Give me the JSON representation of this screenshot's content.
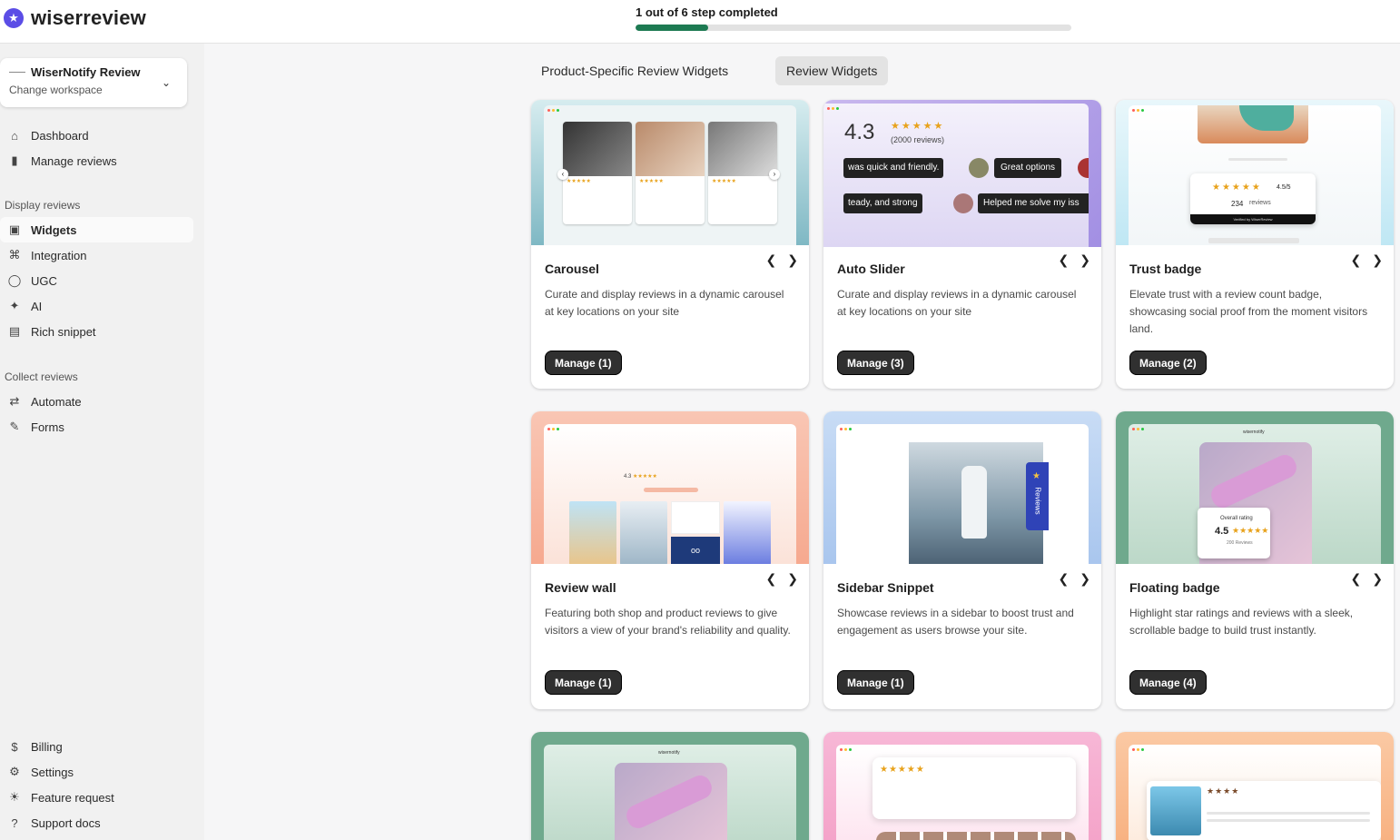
{
  "brand": {
    "logo_text": "wiserreview"
  },
  "progress": {
    "label": "1 out of 6 step completed",
    "completed": 1,
    "total": 6
  },
  "workspace": {
    "name": "WiserNotify Review",
    "action": "Change workspace"
  },
  "nav": {
    "main": [
      {
        "label": "Dashboard",
        "icon": "home-icon"
      },
      {
        "label": "Manage reviews",
        "icon": "document-icon"
      }
    ],
    "display_section": "Display reviews",
    "display": [
      {
        "label": "Widgets",
        "icon": "widget-icon",
        "active": true
      },
      {
        "label": "Integration",
        "icon": "integration-icon"
      },
      {
        "label": "UGC",
        "icon": "globe-icon"
      },
      {
        "label": "AI",
        "icon": "sparkle-icon"
      },
      {
        "label": "Rich snippet",
        "icon": "snippet-icon"
      }
    ],
    "collect_section": "Collect reviews",
    "collect": [
      {
        "label": "Automate",
        "icon": "repeat-icon"
      },
      {
        "label": "Forms",
        "icon": "edit-icon"
      }
    ],
    "bottom": [
      {
        "label": "Billing",
        "icon": "billing-icon"
      },
      {
        "label": "Settings",
        "icon": "gear-icon"
      },
      {
        "label": "Feature request",
        "icon": "sun-icon"
      },
      {
        "label": "Support docs",
        "icon": "help-icon"
      }
    ]
  },
  "tabs": [
    {
      "label": "Product-Specific Review Widgets",
      "active": false
    },
    {
      "label": "Review Widgets",
      "active": true
    }
  ],
  "widgets": [
    {
      "title": "Carousel",
      "description": "Curate and display reviews in a dynamic carousel at key locations on your site",
      "button": "Manage (1)"
    },
    {
      "title": "Auto Slider",
      "description": "Curate and display reviews in a dynamic carousel at key locations on your site",
      "button": "Manage (3)"
    },
    {
      "title": "Trust badge",
      "description": "Elevate trust with a review count badge, showcasing social proof from the moment visitors land.",
      "button": "Manage (2)"
    },
    {
      "title": "Review wall",
      "description": "Featuring both shop and product reviews to give visitors a view of your brand's reliability and quality.",
      "button": "Manage (1)"
    },
    {
      "title": "Sidebar Snippet",
      "description": "Showcase reviews in a sidebar to boost trust and engagement as users browse your site.",
      "button": "Manage (1)"
    },
    {
      "title": "Floating badge",
      "description": "Highlight star ratings and reviews with a sleek, scrollable badge to build trust instantly.",
      "button": "Manage (4)"
    }
  ],
  "previews": {
    "auto_slider": {
      "rating": "4.3",
      "count": "(2000 reviews)",
      "chips_row1": [
        "was quick and friendly.",
        "Great options"
      ],
      "chips_row2": [
        "teady, and strong",
        "Helped me solve my iss"
      ]
    },
    "trust_badge": {
      "rating": "4.5/5",
      "count": "234",
      "count_label": "reviews",
      "footer": "Verified by WiserReview"
    },
    "review_wall": {
      "rating": "4.3"
    },
    "sidebar": {
      "tab_label": "Reviews"
    },
    "floating": {
      "brand": "wisernotify",
      "label": "Overall rating",
      "rating": "4.5",
      "count": "200 Reviews"
    },
    "bottom_brand": "wisernotify"
  },
  "colors": {
    "accent": "#5b4de6",
    "progress": "#1d7a52",
    "button": "#303030",
    "star": "#e8a21b"
  }
}
